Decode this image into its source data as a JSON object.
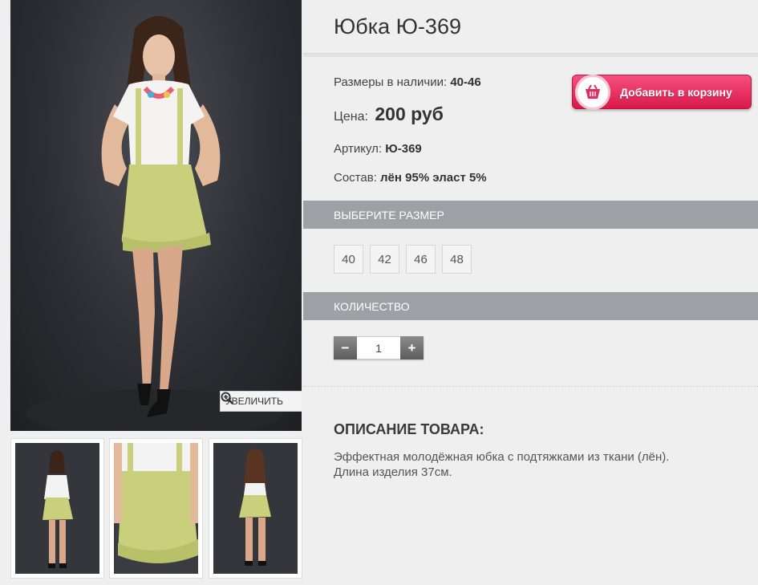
{
  "product": {
    "title": "Юбка Ю-369",
    "sizes_available_label": "Размеры в наличии:",
    "sizes_available_value": "40-46",
    "price_label": "Цена:",
    "price_value": "200 руб",
    "sku_label": "Артикул:",
    "sku_value": "Ю-369",
    "composition_label": "Состав:",
    "composition_value": "лён 95% эласт 5%"
  },
  "cart_button": {
    "label": "Добавить в корзину",
    "icon": "basket-icon"
  },
  "gallery": {
    "zoom_label": "УВЕЛИЧИТЬ",
    "zoom_icon": "magnifier-plus-icon"
  },
  "size_section": {
    "heading": "ВЫБЕРИТЕ РАЗМЕР",
    "options": [
      "40",
      "42",
      "46",
      "48"
    ]
  },
  "quantity_section": {
    "heading": "КОЛИЧЕСТВО",
    "minus": "−",
    "plus": "+",
    "value": "1"
  },
  "description": {
    "heading": "ОПИСАНИЕ ТОВАРА:",
    "line1": "Эффектная молодёжная юбка с подтяжками из ткани (лён).",
    "line2": "Длина изделия 37см."
  },
  "colors": {
    "accent_pink": "#e32b5c",
    "section_bar": "#9da1a6",
    "skirt": "#c9cf7a"
  }
}
